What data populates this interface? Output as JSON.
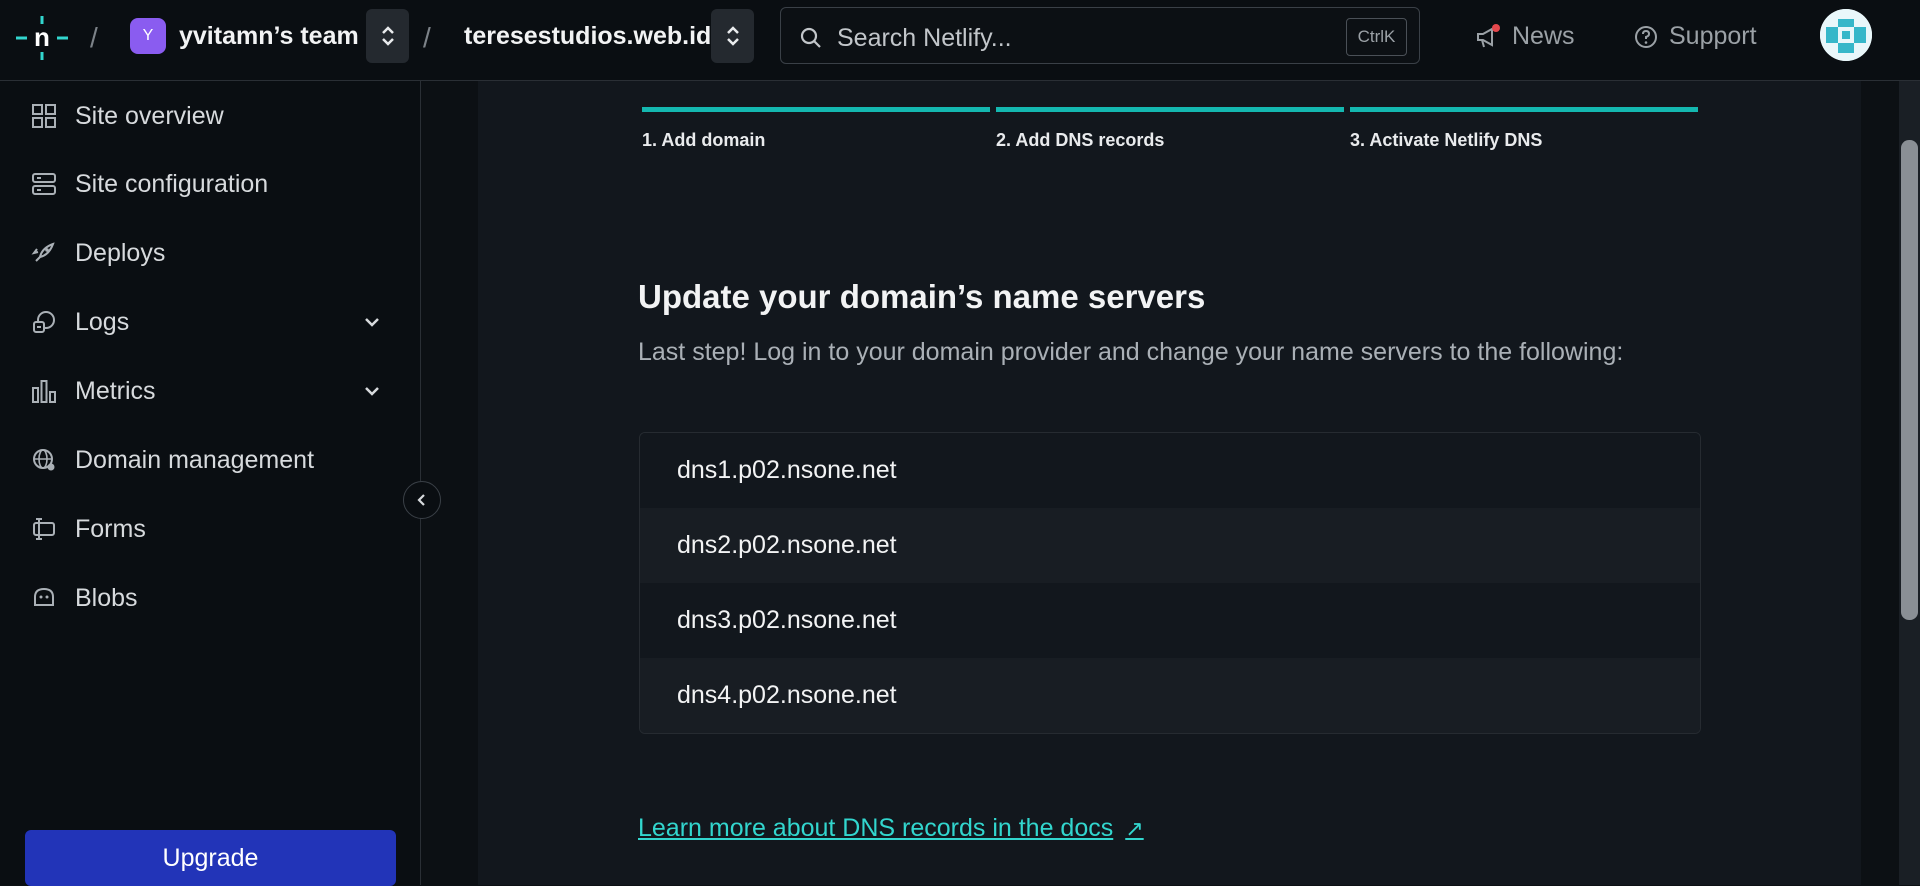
{
  "header": {
    "team_initial": "Y",
    "team_name": "yvitamn’s team",
    "site_name": "teresestudios.web.id",
    "separator": "/",
    "search_placeholder": "Search Netlify...",
    "search_shortcut": "CtrlK",
    "news_label": "News",
    "support_label": "Support"
  },
  "sidebar": {
    "items": [
      {
        "label": "Site overview",
        "icon": "grid-icon"
      },
      {
        "label": "Site configuration",
        "icon": "server-icon"
      },
      {
        "label": "Deploys",
        "icon": "rocket-icon"
      },
      {
        "label": "Logs",
        "icon": "logs-icon",
        "expandable": true
      },
      {
        "label": "Metrics",
        "icon": "bar-chart-icon",
        "expandable": true
      },
      {
        "label": "Domain management",
        "icon": "globe-icon"
      },
      {
        "label": "Forms",
        "icon": "form-icon"
      },
      {
        "label": "Blobs",
        "icon": "blob-icon"
      }
    ],
    "upgrade_label": "Upgrade"
  },
  "steps": [
    {
      "label": "1. Add domain"
    },
    {
      "label": "2. Add DNS records"
    },
    {
      "label": "3. Activate Netlify DNS"
    }
  ],
  "main": {
    "heading": "Update your domain’s name servers",
    "subtitle": "Last step! Log in to your domain provider and change your name servers to the following:",
    "name_servers": [
      "dns1.p02.nsone.net",
      "dns2.p02.nsone.net",
      "dns3.p02.nsone.net",
      "dns4.p02.nsone.net"
    ],
    "docs_link": "Learn more about DNS records in the docs",
    "docs_link_arrow": "↗"
  },
  "colors": {
    "accent": "#14b8b0",
    "link": "#32d6ce",
    "upgrade": "#2234b8",
    "team_avatar": "#8a5cf0",
    "news_dot": "#e5484d"
  }
}
